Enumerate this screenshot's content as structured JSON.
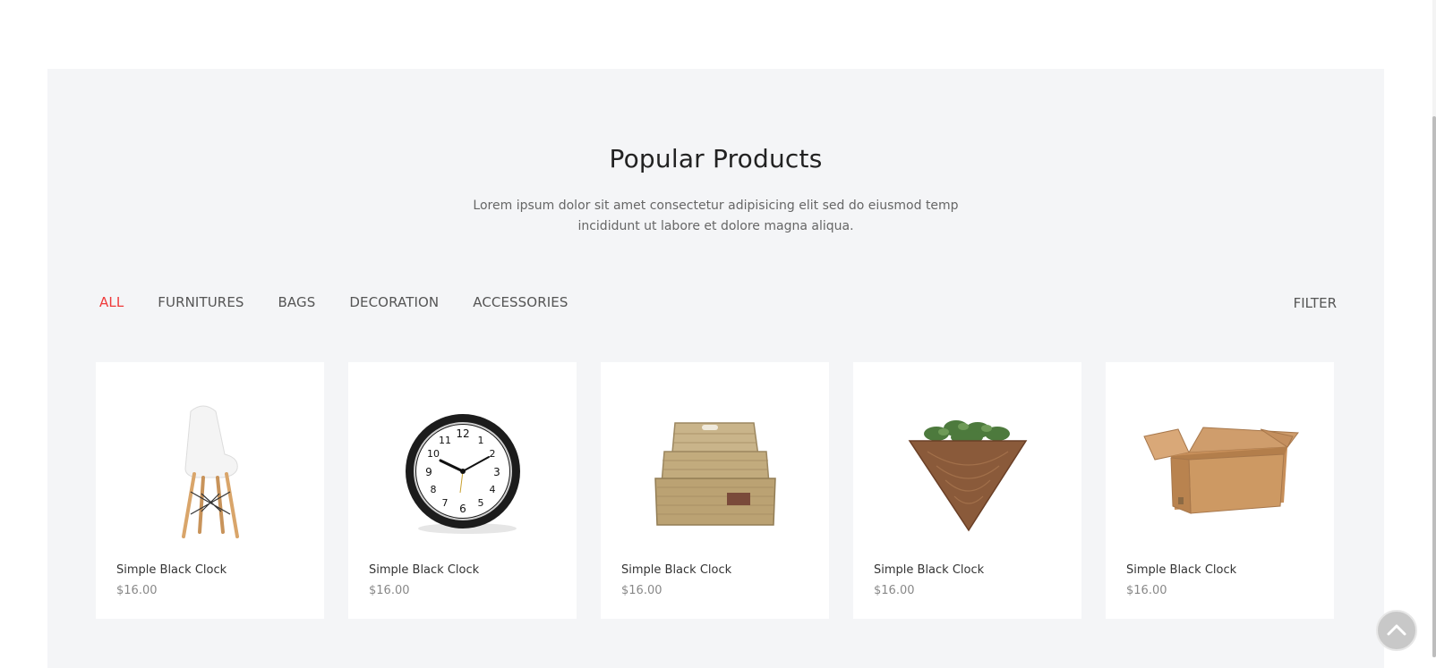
{
  "section": {
    "title": "Popular Products",
    "subtitle": "Lorem ipsum dolor sit amet consectetur adipisicing elit sed do eiusmod temp incididunt ut labore et dolore magna aliqua."
  },
  "tabs": [
    {
      "label": "ALL",
      "active": true
    },
    {
      "label": "FURNITURES",
      "active": false
    },
    {
      "label": "BAGS",
      "active": false
    },
    {
      "label": "DECORATION",
      "active": false
    },
    {
      "label": "ACCESSORIES",
      "active": false
    }
  ],
  "filter_label": "FILTER",
  "products": [
    {
      "name": "Simple Black Clock",
      "price": "$16.00",
      "image": "chair"
    },
    {
      "name": "Simple Black Clock",
      "price": "$16.00",
      "image": "clock"
    },
    {
      "name": "Simple Black Clock",
      "price": "$16.00",
      "image": "basket"
    },
    {
      "name": "Simple Black Clock",
      "price": "$16.00",
      "image": "planter"
    },
    {
      "name": "Simple Black Clock",
      "price": "$16.00",
      "image": "box"
    }
  ],
  "colors": {
    "accent": "#ef3a3a",
    "section_bg": "#f4f5f7",
    "card_bg": "#ffffff"
  },
  "icons": {
    "back_to_top": "chevron-up-icon"
  }
}
